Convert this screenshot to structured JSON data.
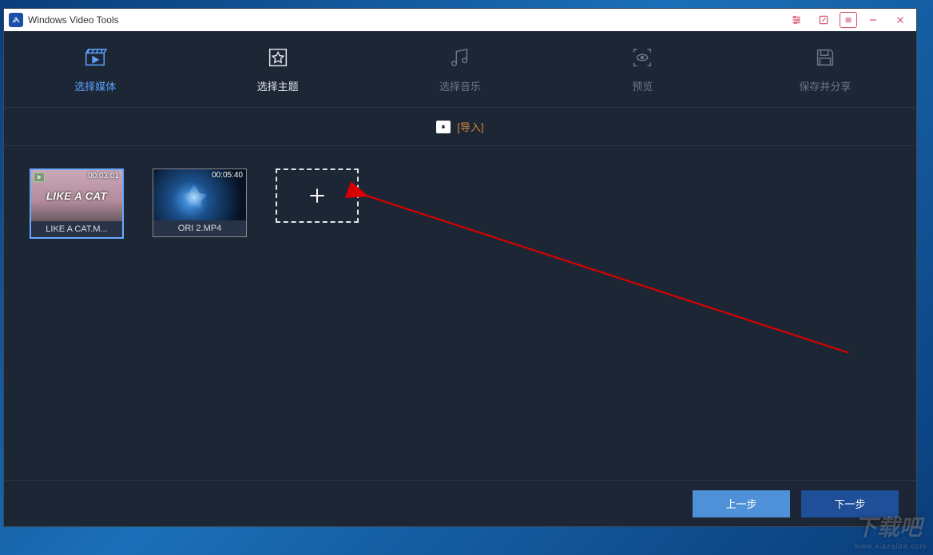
{
  "title": "Windows Video Tools",
  "steps": [
    {
      "id": "select-media",
      "label": "选择媒体",
      "state": "active"
    },
    {
      "id": "select-theme",
      "label": "选择主题",
      "state": "current"
    },
    {
      "id": "select-music",
      "label": "选择音乐",
      "state": "idle"
    },
    {
      "id": "preview",
      "label": "预览",
      "state": "idle"
    },
    {
      "id": "save-share",
      "label": "保存并分享",
      "state": "idle"
    }
  ],
  "import": {
    "label": "[导入]"
  },
  "media": [
    {
      "name": "LIKE A CAT.M...",
      "duration": "00:03:01",
      "overlay": "LIKE A CAT",
      "thumb": "thumb-bg-1",
      "selected": true
    },
    {
      "name": "ORI 2.MP4",
      "duration": "00:05:40",
      "overlay": "",
      "thumb": "thumb-bg-2",
      "selected": false
    }
  ],
  "footer": {
    "prev": "上一步",
    "next": "下一步"
  },
  "watermark": {
    "main": "下载吧",
    "sub": "www.xiazaiba.com"
  }
}
